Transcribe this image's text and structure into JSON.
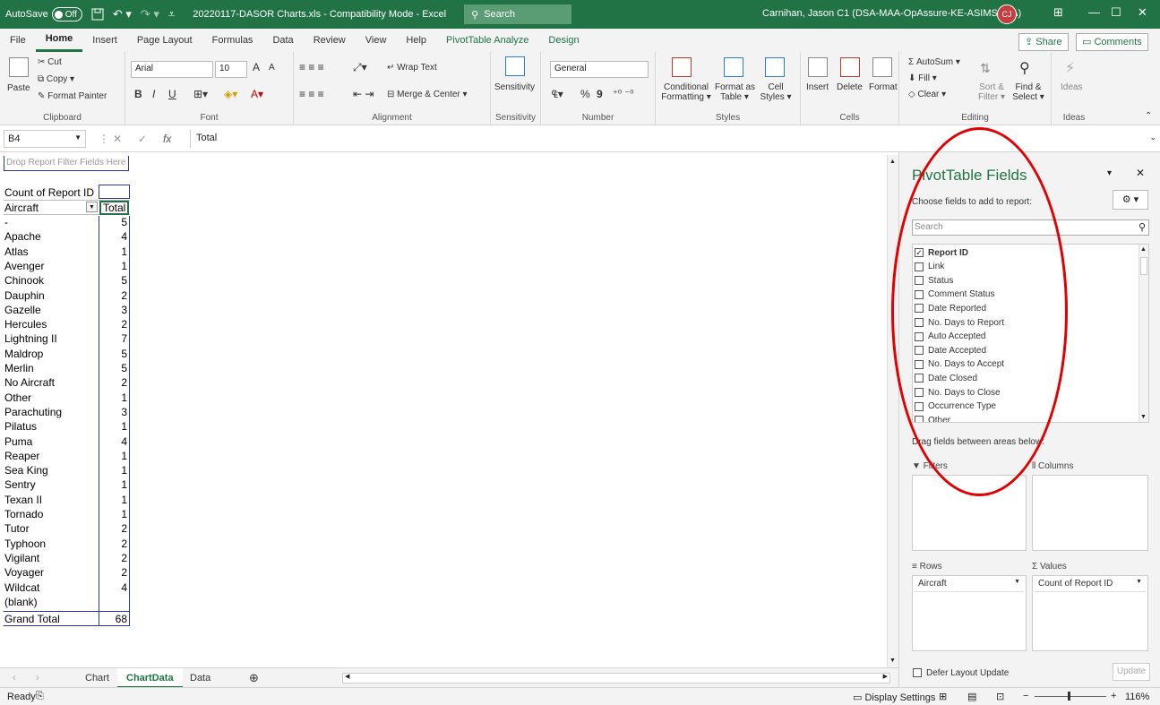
{
  "titlebar": {
    "autosave_label": "AutoSave",
    "autosave_state": "Off",
    "doc_title": "20220117-DASOR Charts.xls - Compatibility Mode - Excel",
    "search_label": "Search",
    "user": "Carnihan, Jason C1 (DSA-MAA-OpAssure-KE-ASIMSDBA)",
    "avatar_initials": "CJ",
    "minimize": "—",
    "restore": "☐",
    "close": "✕"
  },
  "tabs": [
    "File",
    "Home",
    "Insert",
    "Page Layout",
    "Formulas",
    "Data",
    "Review",
    "View",
    "Help",
    "PivotTable Analyze",
    "Design"
  ],
  "share_label": "Share",
  "comments_label": "Comments",
  "ribbon": {
    "clipboard": {
      "paste": "Paste",
      "cut": "Cut",
      "copy": "Copy",
      "format_painter": "Format Painter",
      "label": "Clipboard"
    },
    "font": {
      "name": "Arial",
      "size": "10",
      "label": "Font",
      "grow": "A",
      "shrink": "A",
      "bold": "B",
      "italic": "I",
      "underline": "U"
    },
    "alignment": {
      "wrap": "Wrap Text",
      "merge": "Merge & Center",
      "label": "Alignment"
    },
    "sensitivity": {
      "btn": "Sensitivity",
      "label": "Sensitivity"
    },
    "number": {
      "format": "General",
      "label": "Number",
      "percent": "%",
      "comma": "9",
      "currency": "₠"
    },
    "styles": {
      "conditional": "Conditional",
      "conditional2": "Formatting",
      "format_as": "Format as",
      "format_as2": "Table",
      "cell": "Cell",
      "cell2": "Styles",
      "label": "Styles"
    },
    "cells": {
      "insert": "Insert",
      "delete": "Delete",
      "format": "Format",
      "label": "Cells"
    },
    "editing": {
      "autosum": "AutoSum",
      "fill": "Fill",
      "clear": "Clear",
      "sort": "Sort &",
      "sort2": "Filter",
      "find": "Find &",
      "find2": "Select",
      "label": "Editing"
    },
    "ideas": {
      "btn": "Ideas",
      "label": "Ideas"
    }
  },
  "formula_bar": {
    "name_box": "B4",
    "cancel": "✕",
    "enter": "✓",
    "fx": "fx",
    "value": "Total"
  },
  "sheet": {
    "report_filter": "Drop Report Filter Fields Here",
    "value_header": "Count of Report ID",
    "row_header": "Aircraft",
    "col_header": "Total",
    "rows": [
      {
        "label": "-",
        "value": "5"
      },
      {
        "label": "Apache",
        "value": "4"
      },
      {
        "label": "Atlas",
        "value": "1"
      },
      {
        "label": "Avenger",
        "value": "1"
      },
      {
        "label": "Chinook",
        "value": "5"
      },
      {
        "label": "Dauphin",
        "value": "2"
      },
      {
        "label": "Gazelle",
        "value": "3"
      },
      {
        "label": "Hercules",
        "value": "2"
      },
      {
        "label": "Lightning II",
        "value": "7"
      },
      {
        "label": "Maldrop",
        "value": "5"
      },
      {
        "label": "Merlin",
        "value": "5"
      },
      {
        "label": "No Aircraft",
        "value": "2"
      },
      {
        "label": "Other",
        "value": "1"
      },
      {
        "label": "Parachuting",
        "value": "3"
      },
      {
        "label": "Pilatus",
        "value": "1"
      },
      {
        "label": "Puma",
        "value": "4"
      },
      {
        "label": "Reaper",
        "value": "1"
      },
      {
        "label": "Sea King",
        "value": "1"
      },
      {
        "label": "Sentry",
        "value": "1"
      },
      {
        "label": "Texan II",
        "value": "1"
      },
      {
        "label": "Tornado",
        "value": "1"
      },
      {
        "label": "Tutor",
        "value": "2"
      },
      {
        "label": "Typhoon",
        "value": "2"
      },
      {
        "label": "Vigilant",
        "value": "2"
      },
      {
        "label": "Voyager",
        "value": "2"
      },
      {
        "label": "Wildcat",
        "value": "4"
      },
      {
        "label": "(blank)",
        "value": ""
      }
    ],
    "grand_total_label": "Grand Total",
    "grand_total_value": "68"
  },
  "sheet_tabs": [
    "Chart",
    "ChartData",
    "Data"
  ],
  "active_sheet": "ChartData",
  "status": {
    "ready": "Ready",
    "display_settings": "Display Settings",
    "zoom": "116%",
    "minus": "−",
    "plus": "+"
  },
  "pivot_pane": {
    "title": "PivotTable Fields",
    "subtitle": "Choose fields to add to report:",
    "search_placeholder": "Search",
    "fields": [
      {
        "label": "Report ID",
        "checked": true
      },
      {
        "label": "Link",
        "checked": false
      },
      {
        "label": "Status",
        "checked": false
      },
      {
        "label": "Comment Status",
        "checked": false
      },
      {
        "label": "Date Reported",
        "checked": false
      },
      {
        "label": "No. Days to Report",
        "checked": false
      },
      {
        "label": "Auto Accepted",
        "checked": false
      },
      {
        "label": "Date Accepted",
        "checked": false
      },
      {
        "label": "No. Days to Accept",
        "checked": false
      },
      {
        "label": "Date Closed",
        "checked": false
      },
      {
        "label": "No. Days to Close",
        "checked": false
      },
      {
        "label": "Occurrence Type",
        "checked": false
      },
      {
        "label": "Other",
        "checked": false
      }
    ],
    "drag_hint": "Drag fields between areas below:",
    "areas": {
      "filters": "Filters",
      "columns": "Columns",
      "rows": "Rows",
      "values": "Values"
    },
    "rows_field": "Aircraft",
    "values_field": "Count of Report ID",
    "defer_label": "Defer Layout Update",
    "update_label": "Update"
  }
}
